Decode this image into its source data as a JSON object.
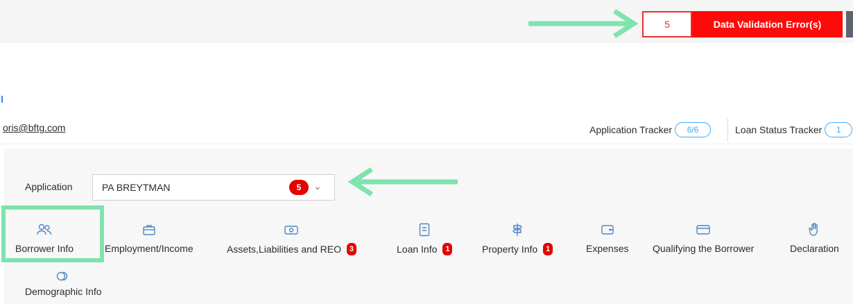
{
  "header": {
    "error_count": "5",
    "error_label": "Data Validation Error(s)"
  },
  "user": {
    "email": "oris@bftg.com"
  },
  "trackers": [
    {
      "label": "Application Tracker",
      "value": "6/6"
    },
    {
      "label": "Loan Status Tracker",
      "value": "1"
    }
  ],
  "application": {
    "label": "Application",
    "selected": "PA BREYTMAN",
    "badge": "5"
  },
  "tabs": [
    {
      "label": "Borrower Info",
      "icon": "users-icon"
    },
    {
      "label": "Employment/Income",
      "icon": "briefcase-icon"
    },
    {
      "label": "Assets,Liabilities and REO",
      "icon": "cash-icon",
      "badge": "3"
    },
    {
      "label": "Loan Info",
      "icon": "document-icon",
      "badge": "1"
    },
    {
      "label": "Property Info",
      "icon": "signpost-icon",
      "badge": "1"
    },
    {
      "label": "Expenses",
      "icon": "wallet-icon"
    },
    {
      "label": "Qualifying the Borrower",
      "icon": "credit-card-icon"
    },
    {
      "label": "Declaration",
      "icon": "hand-icon"
    },
    {
      "label": "Demographic Info",
      "icon": "coins-icon"
    }
  ],
  "colors": {
    "error_red": "#ff0a0a",
    "badge_red": "#e60000",
    "accent_blue": "#3fa9f5",
    "icon_blue": "#4a86c5",
    "annotation_green": "#7fe3ae"
  }
}
